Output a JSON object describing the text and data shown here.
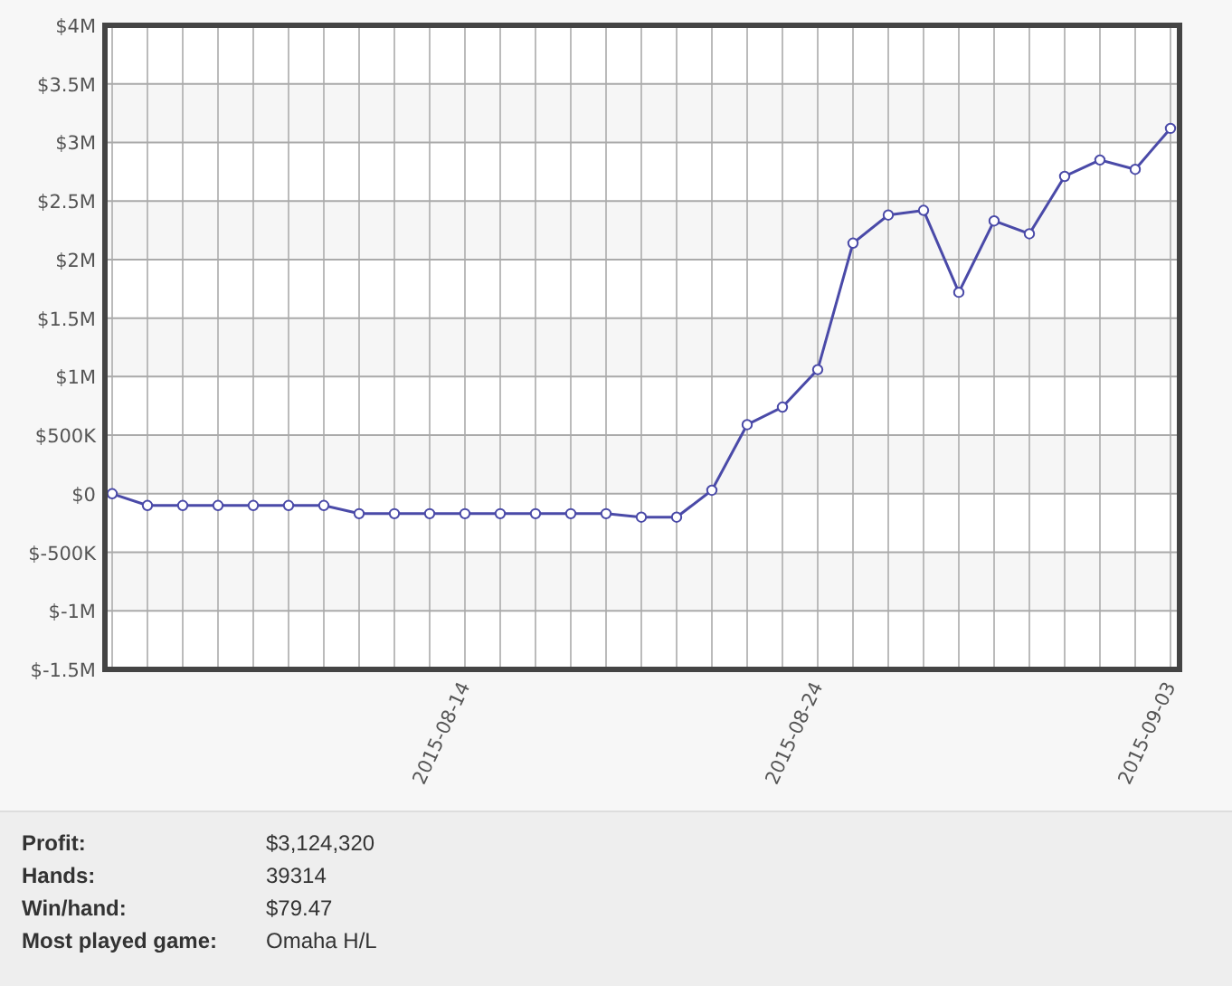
{
  "chart": {
    "chart_data": {
      "type": "line",
      "grid": true,
      "categories": [
        null,
        null,
        null,
        null,
        null,
        null,
        null,
        null,
        null,
        null,
        "2015-08-14",
        null,
        null,
        null,
        null,
        null,
        null,
        null,
        null,
        null,
        "2015-08-24",
        null,
        null,
        null,
        null,
        null,
        null,
        null,
        null,
        null,
        "2015-09-03"
      ],
      "series": [
        {
          "color": "#4a4aa8",
          "marker": "circle",
          "values": [
            0,
            -100000,
            -100000,
            -100000,
            -100000,
            -100000,
            -100000,
            -170000,
            -170000,
            -170000,
            -170000,
            -170000,
            -170000,
            -170000,
            -170000,
            -200000,
            -200000,
            30000,
            590000,
            740000,
            1060000,
            2140000,
            2380000,
            2420000,
            1720000,
            2330000,
            2220000,
            2710000,
            2850000,
            2770000,
            3120000
          ]
        }
      ],
      "ylim": [
        -1500000,
        4000000
      ],
      "yticks": [
        {
          "value": 4000000,
          "label": "$4M"
        },
        {
          "value": 3500000,
          "label": "$3.5M"
        },
        {
          "value": 3000000,
          "label": "$3M"
        },
        {
          "value": 2500000,
          "label": "$2.5M"
        },
        {
          "value": 2000000,
          "label": "$2M"
        },
        {
          "value": 1500000,
          "label": "$1.5M"
        },
        {
          "value": 1000000,
          "label": "$1M"
        },
        {
          "value": 500000,
          "label": "$500K"
        },
        {
          "value": 0,
          "label": "$0"
        },
        {
          "value": -500000,
          "label": "$-500K"
        },
        {
          "value": -1000000,
          "label": "$-1M"
        },
        {
          "value": -1500000,
          "label": "$-1.5M"
        }
      ]
    }
  },
  "stats": [
    {
      "label": "Profit:",
      "value": "$3,124,320"
    },
    {
      "label": "Hands:",
      "value": "39314"
    },
    {
      "label": "Win/hand:",
      "value": "$79.47"
    },
    {
      "label": "Most played game:",
      "value": "Omaha H/L"
    }
  ]
}
